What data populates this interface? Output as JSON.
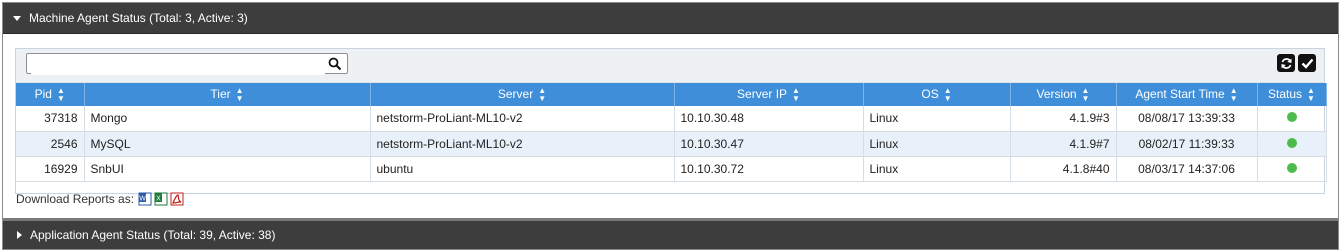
{
  "machine_panel": {
    "title": "Machine Agent Status (Total: 3, Active: 3)"
  },
  "search": {
    "value": "",
    "placeholder": ""
  },
  "toolbar": {
    "refresh_icon": "refresh-icon",
    "check_icon": "check-icon"
  },
  "table": {
    "columns": [
      "Pid",
      "Tier",
      "Server",
      "Server IP",
      "OS",
      "Version",
      "Agent Start Time",
      "Status"
    ],
    "rows": [
      {
        "pid": "37318",
        "tier": "Mongo",
        "server": "netstorm-ProLiant-ML10-v2",
        "ip": "10.10.30.48",
        "os": "Linux",
        "version": "4.1.9#3",
        "start": "08/08/17 13:39:33",
        "status": "active"
      },
      {
        "pid": "2546",
        "tier": "MySQL",
        "server": "netstorm-ProLiant-ML10-v2",
        "ip": "10.10.30.47",
        "os": "Linux",
        "version": "4.1.9#7",
        "start": "08/02/17 11:39:33",
        "status": "active"
      },
      {
        "pid": "16929",
        "tier": "SnbUI",
        "server": "ubuntu",
        "ip": "10.10.30.72",
        "os": "Linux",
        "version": "4.1.8#40",
        "start": "08/03/17 14:37:06",
        "status": "active"
      }
    ]
  },
  "download": {
    "label": "Download Reports as:",
    "formats": [
      "word-icon",
      "excel-icon",
      "pdf-icon"
    ]
  },
  "application_panel": {
    "title": "Application Agent Status (Total: 39, Active: 38)"
  },
  "colors": {
    "header": "#3d3d3d",
    "table_header": "#3e8ed9",
    "status_active": "#4cbb4c",
    "alt_row": "#e8f1fa"
  }
}
